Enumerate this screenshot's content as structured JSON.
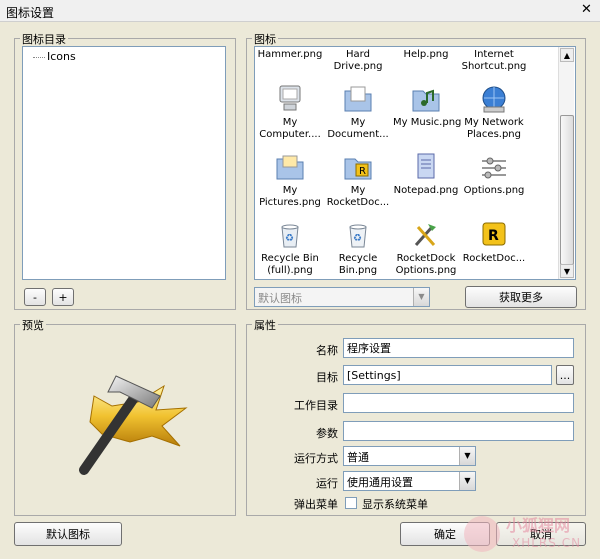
{
  "window": {
    "title": "图标设置",
    "close": "✕"
  },
  "tree": {
    "label": "图标目录",
    "root": "Icons",
    "minus": "-",
    "plus": "+"
  },
  "gallery": {
    "label": "图标",
    "top_row": [
      "Hammer.png",
      "Hard\nDrive.png",
      "Help.png",
      "Internet\nShortcut.png"
    ],
    "rows": [
      [
        "My\nComputer....",
        "My\nDocument...",
        "My Music.png",
        "My Network\nPlaces.png"
      ],
      [
        "My\nPictures.png",
        "My\nRocketDoc...",
        "Notepad.png",
        "Options.png"
      ],
      [
        "Recycle Bin\n(full).png",
        "Recycle\nBin.png",
        "RocketDock\nOptions.png",
        "RocketDoc..."
      ]
    ],
    "icon_names": [
      [
        "computer-icon",
        "documents-folder-icon",
        "music-folder-icon",
        "network-icon"
      ],
      [
        "pictures-folder-icon",
        "rocketdock-folder-icon",
        "notepad-icon",
        "options-icon"
      ],
      [
        "recycle-bin-full-icon",
        "recycle-bin-icon",
        "rocketdock-options-icon",
        "rocketdock-icon"
      ]
    ],
    "default_select": "默认图标",
    "get_more": "获取更多"
  },
  "preview": {
    "label": "预览"
  },
  "properties": {
    "label": "属性",
    "name_label": "名称",
    "name_value": "程序设置",
    "target_label": "目标",
    "target_value": "[Settings]",
    "browse": "...",
    "workdir_label": "工作目录",
    "workdir_value": "",
    "args_label": "参数",
    "args_value": "",
    "runmode_label": "运行方式",
    "runmode_value": "普通",
    "run_label": "运行",
    "run_value": "使用通用设置",
    "popup_label": "弹出菜单",
    "popup_checkbox": "显示系统菜单"
  },
  "footer": {
    "default_icon": "默认图标",
    "ok": "确定",
    "cancel": "取消"
  },
  "watermark": {
    "text": "小狐狸网",
    "url": "XHLRS.CN"
  }
}
